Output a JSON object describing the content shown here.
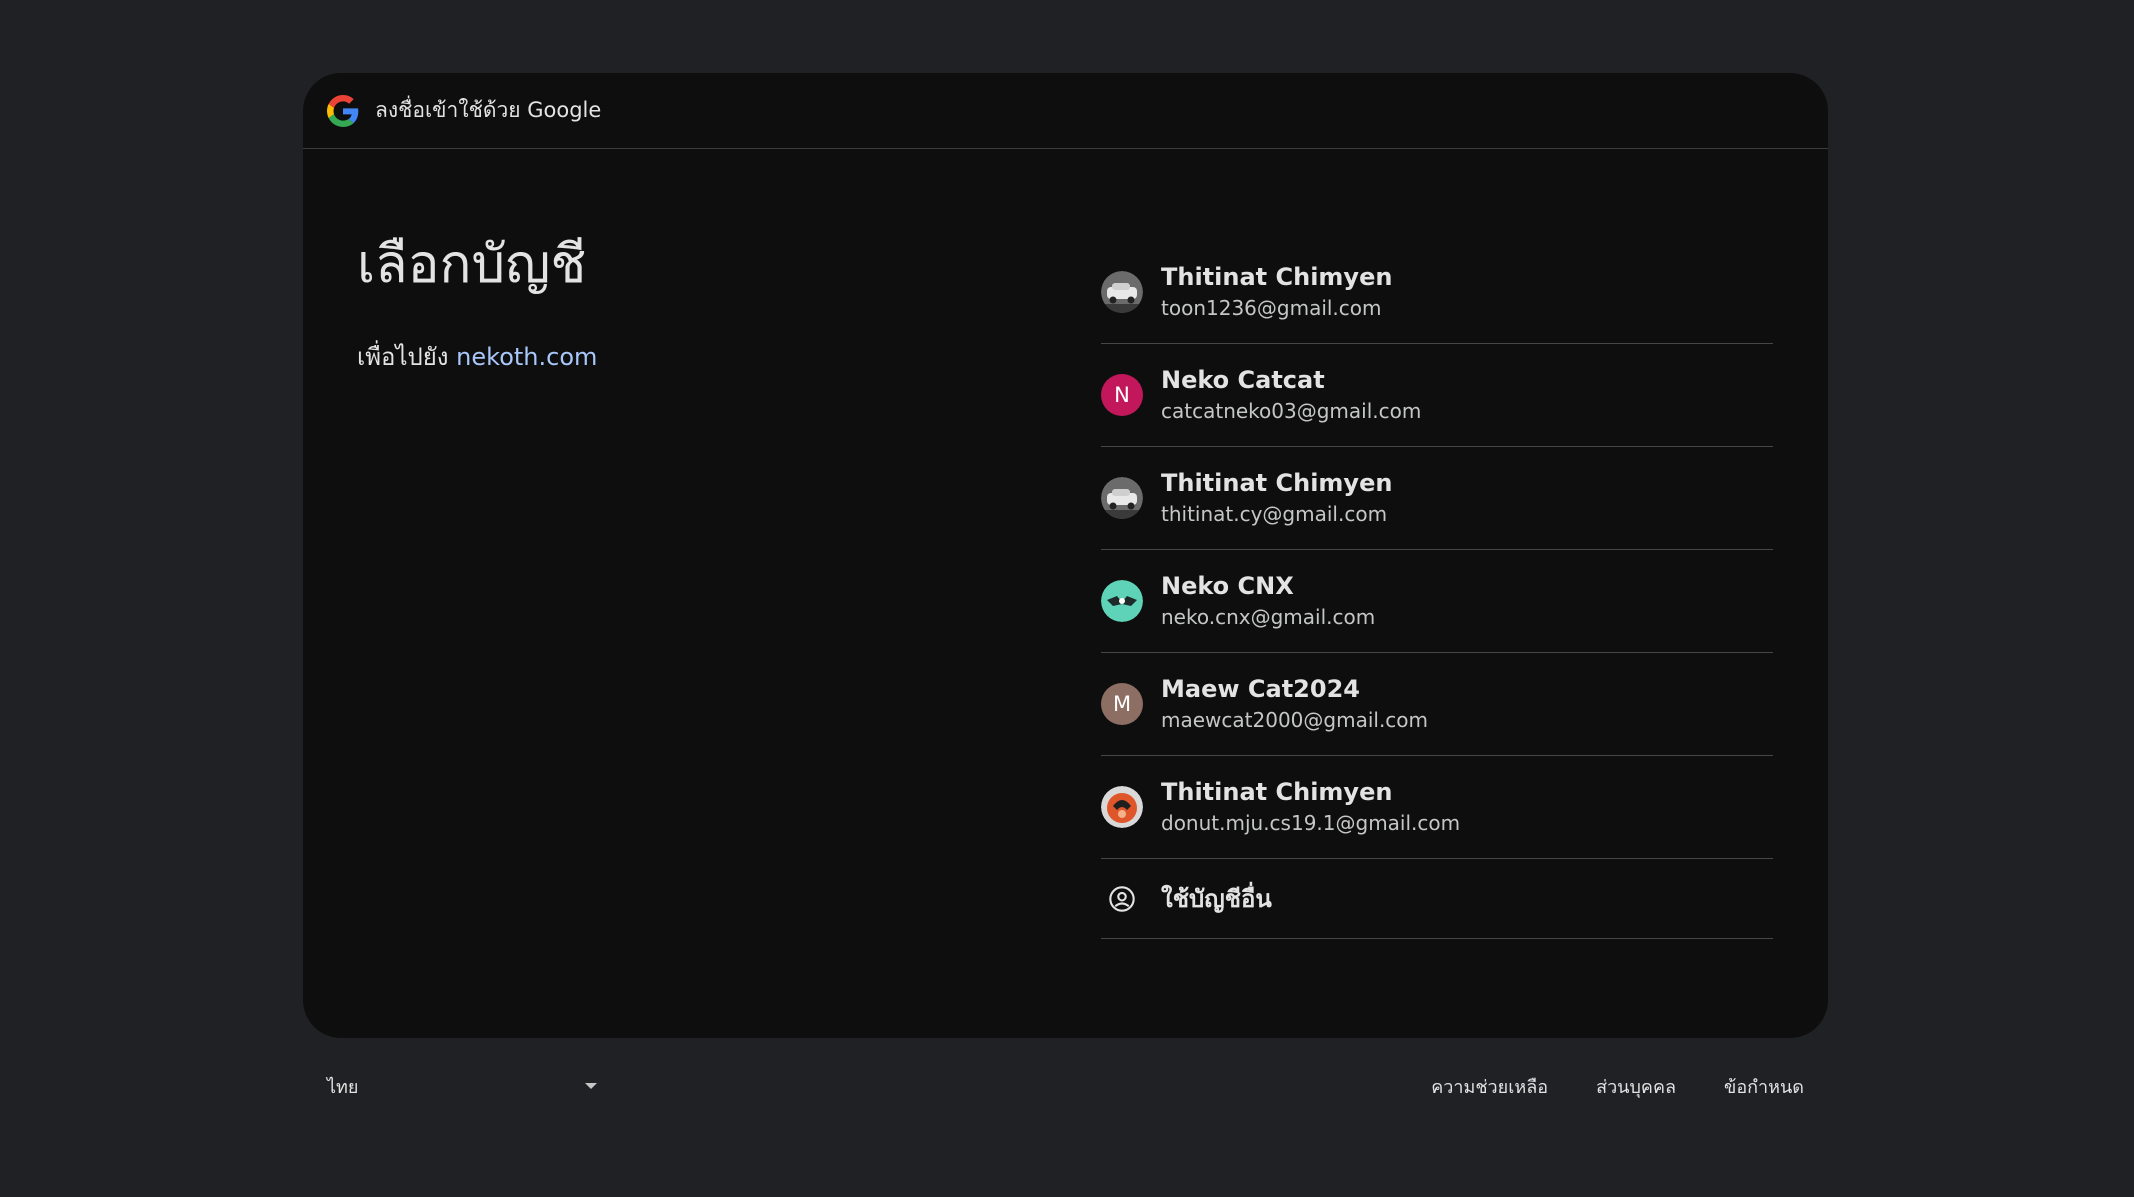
{
  "header": {
    "title": "ลงชื่อเข้าใช้ด้วย Google",
    "logo_icon": "google-g-icon"
  },
  "main": {
    "title": "เลือกบัญชี",
    "subtitle_prefix": "เพื่อไปยัง",
    "site_link": "nekoth.com"
  },
  "accounts": [
    {
      "name": "Thitinat Chimyen",
      "email": "toon1236@gmail.com",
      "avatar": "photo-car"
    },
    {
      "name": "Neko Catcat",
      "email": "catcatneko03@gmail.com",
      "avatar": "letter",
      "initial": "N",
      "color": "#c2185b"
    },
    {
      "name": "Thitinat Chimyen",
      "email": "thitinat.cy@gmail.com",
      "avatar": "photo-car"
    },
    {
      "name": "Neko CNX",
      "email": "neko.cnx@gmail.com",
      "avatar": "photo-teal"
    },
    {
      "name": "Maew Cat2024",
      "email": "maewcat2000@gmail.com",
      "avatar": "letter",
      "initial": "M",
      "color": "#8d6e63"
    },
    {
      "name": "Thitinat Chimyen",
      "email": "donut.mju.cs19.1@gmail.com",
      "avatar": "photo-orange"
    }
  ],
  "other_account": {
    "label": "ใช้บัญชีอื่น",
    "icon": "account-circle-icon"
  },
  "footer": {
    "language": "ไทย",
    "links": [
      "ความช่วยเหลือ",
      "ส่วนบุคคล",
      "ข้อกำหนด"
    ]
  },
  "colors": {
    "background": "#202124",
    "card": "#0e0e0e",
    "link": "#a8c7fa",
    "divider": "#444746"
  }
}
